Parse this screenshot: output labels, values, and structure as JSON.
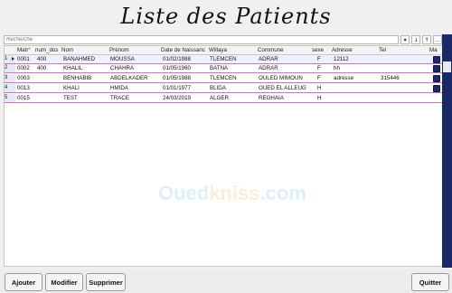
{
  "window": {
    "title": "Liste des Patients"
  },
  "search": {
    "placeholder": "Recherche",
    "buttons": [
      "▾",
      "↓",
      "↑",
      "…"
    ]
  },
  "table": {
    "columns": [
      "Matr°",
      "num_dos",
      "Nom",
      "Prénom",
      "Date de Naissanc",
      "Willaya",
      "Commune",
      "sexe",
      "Adresse",
      "Tel",
      "Ma"
    ],
    "rows": [
      {
        "num": "1",
        "selected": true,
        "cells": [
          "0001",
          "400",
          "BANAHMED",
          "MOUSSA",
          "01/02/1988",
          "TLEMCEN",
          "ADRAR",
          "F",
          "12112",
          ""
        ]
      },
      {
        "num": "2",
        "selected": false,
        "cells": [
          "0002",
          "400",
          "KHALIL",
          "CHAHRA",
          "01/05/1960",
          "BATNA",
          "ADRAR",
          "F",
          "hh",
          ""
        ]
      },
      {
        "num": "3",
        "selected": false,
        "cells": [
          "0003",
          "",
          "BENHABIB",
          "ABDELKADER",
          "01/05/1988",
          "TLEMCEN",
          "OULED MIMOUN",
          "F",
          "adresse",
          "315446"
        ]
      },
      {
        "num": "4",
        "selected": false,
        "cells": [
          "0013",
          "",
          "KHALI",
          "HMIDA",
          "01/01/1977",
          "BLIDA",
          "OUED EL ALLEUG",
          "H",
          "",
          ""
        ]
      },
      {
        "num": "5",
        "selected": false,
        "cells": [
          "0015",
          "",
          "TEST",
          "TRACE",
          "24/03/2019",
          "ALGER",
          "REGHAIA",
          "H",
          "",
          ""
        ]
      }
    ]
  },
  "watermark": {
    "part1": "Oued",
    "part2": "kniss",
    "part3": ".com"
  },
  "buttons": {
    "add": "Ajouter",
    "edit": "Modifier",
    "delete": "Supprimer",
    "quit": "Quitter"
  },
  "colors": {
    "row_separator": "#d070c8",
    "scrollbar": "#1a2868",
    "edit_icon": "#1a2a6a"
  }
}
